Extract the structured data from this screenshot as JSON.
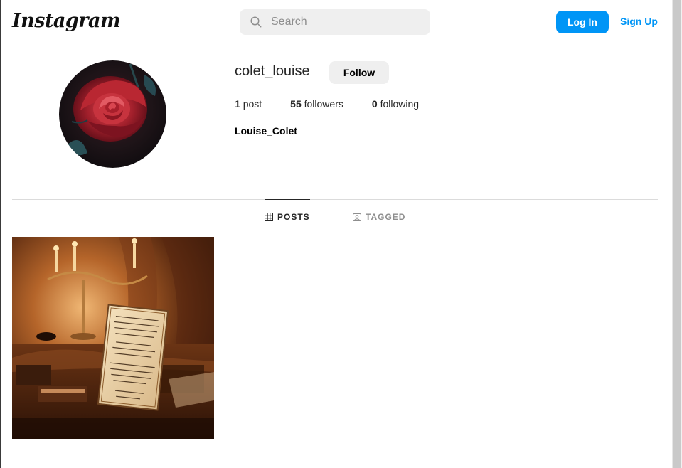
{
  "header": {
    "logo_text": "Instagram",
    "search_placeholder": "Search",
    "login_label": "Log In",
    "signup_label": "Sign Up",
    "accent_color": "#0095f6"
  },
  "profile": {
    "username": "colet_louise",
    "follow_label": "Follow",
    "stats": {
      "posts_count": "1",
      "posts_label": "post",
      "followers_count": "55",
      "followers_label": "followers",
      "following_count": "0",
      "following_label": "following"
    },
    "full_name": "Louise_Colet",
    "avatar_icon": "red-rose-image"
  },
  "tabs": [
    {
      "label": "POSTS",
      "icon": "grid-icon",
      "active": true
    },
    {
      "label": "TAGGED",
      "icon": "tagged-icon",
      "active": false
    }
  ],
  "posts": [
    {
      "icon": "letter-on-desk-image"
    }
  ]
}
